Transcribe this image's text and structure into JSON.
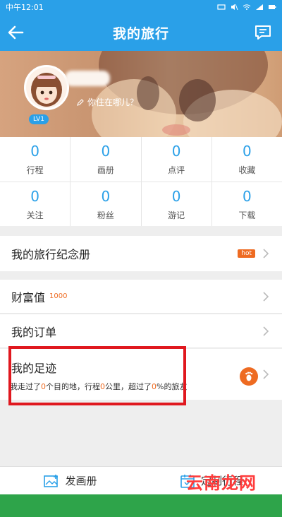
{
  "status_bar": {
    "carrier": "中午12:01"
  },
  "header": {
    "title": "我的旅行"
  },
  "profile": {
    "level": "LV1",
    "location": "你住在哪儿？"
  },
  "stats_row1": [
    {
      "value": "0",
      "label": "行程"
    },
    {
      "value": "0",
      "label": "画册"
    },
    {
      "value": "0",
      "label": "点评"
    },
    {
      "value": "0",
      "label": "收藏"
    }
  ],
  "stats_row2": [
    {
      "value": "0",
      "label": "关注"
    },
    {
      "value": "0",
      "label": "粉丝"
    },
    {
      "value": "0",
      "label": "游记"
    },
    {
      "value": "0",
      "label": "下载"
    }
  ],
  "menu": {
    "souvenir": {
      "label": "我的旅行纪念册",
      "badge": "hot"
    },
    "wealth": {
      "label": "财富值",
      "value": "1000"
    },
    "orders": {
      "label": "我的订单"
    },
    "footprint": {
      "label": "我的足迹",
      "desc_1": "我走过了",
      "places": "0",
      "desc_2": "个目的地，行程",
      "distance": "0",
      "desc_3": "公里，超过了",
      "percent": "0",
      "desc_4": "%的旅友"
    }
  },
  "bottom_bar": {
    "album_label": "发画册",
    "plan_label": "定制行程"
  },
  "watermark": {
    "main": "云南龙网",
    "suffix": ""
  },
  "colors": {
    "primary": "#2aa0e8",
    "accent": "#ee6b22",
    "highlight_frame": "#e0181f"
  }
}
